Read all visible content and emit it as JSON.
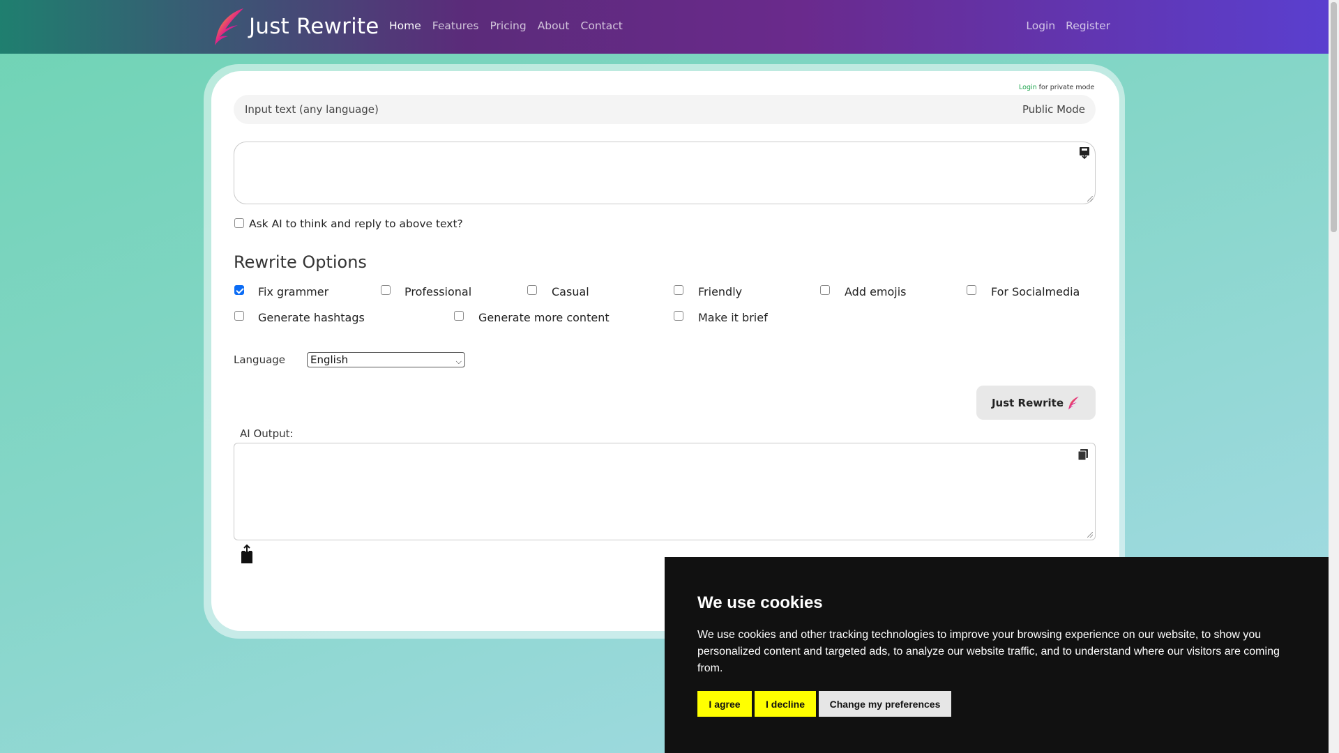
{
  "nav": {
    "brand": "Just Rewrite",
    "links": [
      "Home",
      "Features",
      "Pricing",
      "About",
      "Contact"
    ],
    "active": "Home",
    "right": [
      "Login",
      "Register"
    ]
  },
  "private_note": {
    "link": "Login",
    "text": "for private mode"
  },
  "input_bar": {
    "label": "Input text (any language)",
    "mode": "Public Mode"
  },
  "input_textarea": {
    "value": ""
  },
  "think_option": {
    "label": "Ask AI to think and reply to above text?",
    "checked": false
  },
  "rewrite_options": {
    "title": "Rewrite Options",
    "items": [
      {
        "label": "Fix grammer",
        "checked": true
      },
      {
        "label": "Professional",
        "checked": false
      },
      {
        "label": "Casual",
        "checked": false
      },
      {
        "label": "Friendly",
        "checked": false
      },
      {
        "label": "Add emojis",
        "checked": false
      },
      {
        "label": "For Socialmedia",
        "checked": false
      },
      {
        "label": "Generate hashtags",
        "checked": false
      },
      {
        "label": "Generate more content",
        "checked": false
      },
      {
        "label": "Make it brief",
        "checked": false
      }
    ]
  },
  "language": {
    "label": "Language",
    "selected": "English"
  },
  "rewrite_button": {
    "label": "Just Rewrite"
  },
  "output": {
    "label": "AI Output:",
    "value": ""
  },
  "cookie": {
    "title": "We use cookies",
    "text": "We use cookies and other tracking technologies to improve your browsing experience on our website, to show you personalized content and targeted ads, to analyze our website traffic, and to understand where our visitors are coming from.",
    "agree": "I agree",
    "decline": "I decline",
    "preferences": "Change my preferences"
  },
  "colors": {
    "accent": "#0b6cf5",
    "cookie_button": "#ffff00",
    "nav_start": "#1f7f6f",
    "nav_end": "#5a3fcf"
  }
}
